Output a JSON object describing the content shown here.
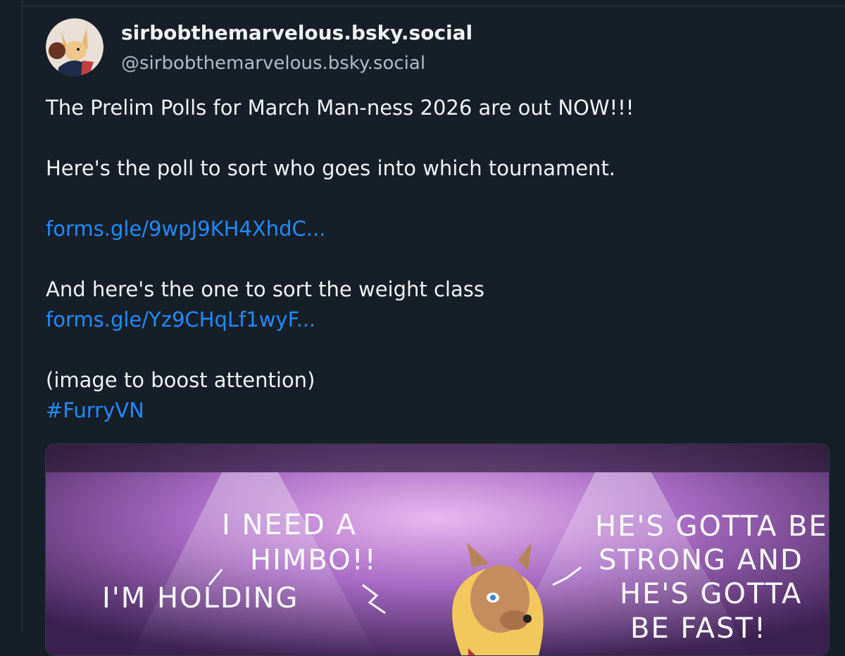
{
  "post": {
    "author": {
      "display_name": "sirbobthemarvelous.bsky.social",
      "handle": "@sirbobthemarvelous.bsky.social"
    },
    "text": {
      "line1": "The Prelim Polls for March Man-ness 2026 are out NOW!!!",
      "line2": "Here's the poll to sort who goes into which tournament.",
      "link1": "forms.gle/9wpJ9KH4XhdC...",
      "line3": "And here's the one to sort the weight class",
      "link2": "forms.gle/Yz9CHqLf1wyF...",
      "line4": "(image to boost attention)",
      "hashtag": "#FurryVN"
    },
    "image": {
      "bubble_left_1": "I NEED A",
      "bubble_left_2": "HIMBO!!",
      "bubble_left_3": "I'M HOLDING",
      "bubble_right_1": "HE'S GOTTA BE",
      "bubble_right_2": "STRONG AND",
      "bubble_right_3": "HE'S GOTTA",
      "bubble_right_4": "BE FAST!"
    }
  },
  "colors": {
    "background": "#161e27",
    "link": "#208bfe",
    "text": "#f1f3f5",
    "muted": "#aebbc9"
  }
}
